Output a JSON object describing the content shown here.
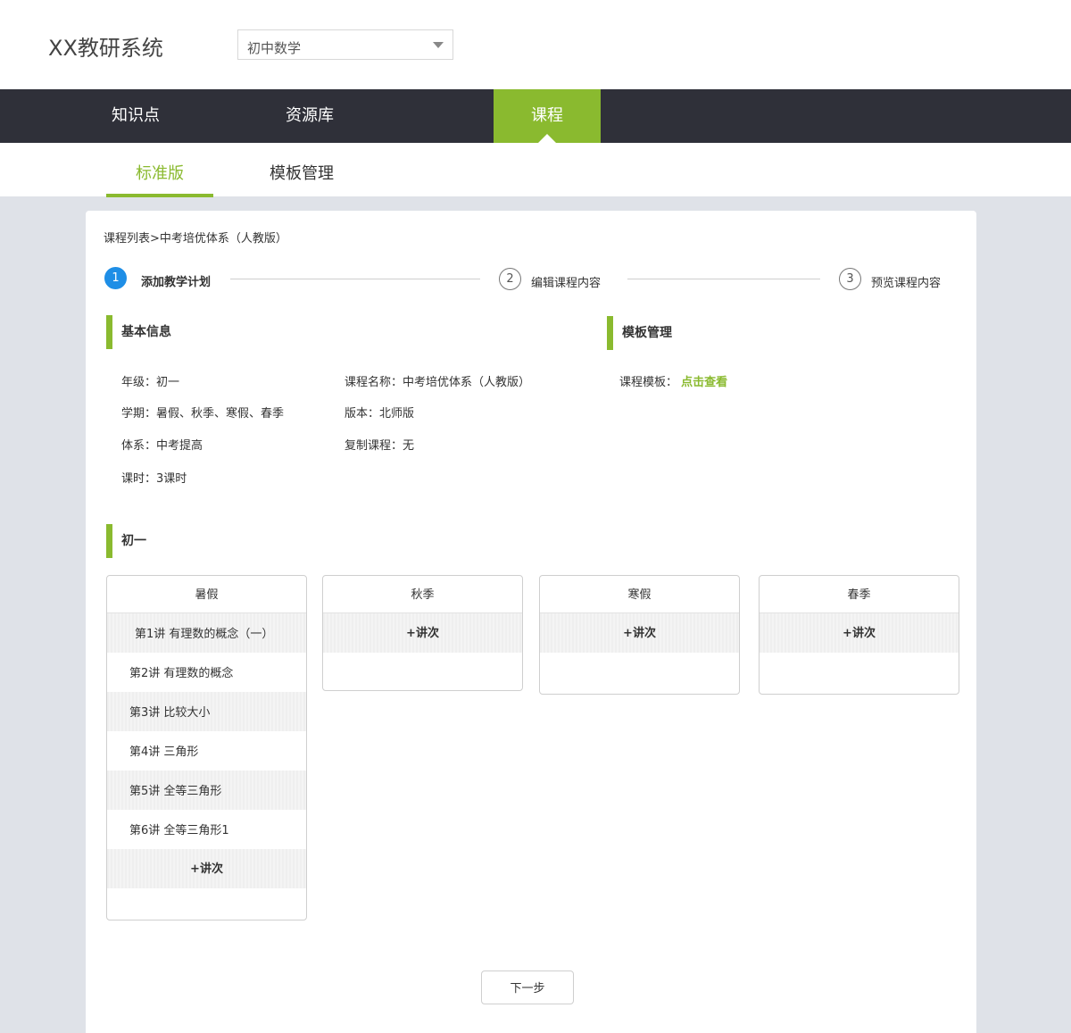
{
  "header": {
    "logo": "XX教研系统",
    "subject_select": "初中数学"
  },
  "topnav": {
    "items": [
      "知识点",
      "资源库",
      "课程"
    ],
    "active": "课程"
  },
  "subnav": {
    "items": [
      "标准版",
      "模板管理"
    ],
    "active": "标准版"
  },
  "breadcrumb": "课程列表>中考培优体系（人教版）",
  "steps": [
    {
      "num": "1",
      "label": "添加教学计划"
    },
    {
      "num": "2",
      "label": "编辑课程内容"
    },
    {
      "num": "3",
      "label": "预览课程内容"
    }
  ],
  "basic_info": {
    "title": "基本信息",
    "grade": "年级：初一",
    "term": "学期：暑假、秋季、寒假、春季",
    "system": "体系：中考提高",
    "hours": "课时：3课时",
    "course_name": "课程名称：中考培优体系（人教版）",
    "edition": "版本：北师版",
    "copy_course": "复制课程：无"
  },
  "template_mgmt": {
    "title": "模板管理",
    "label": "课程模板：",
    "link": "点击查看"
  },
  "grade_section": {
    "title": "初一",
    "terms": [
      {
        "name": "暑假",
        "lessons": [
          "第1讲 有理数的概念（一）",
          "第2讲 有理数的概念",
          "第3讲 比较大小",
          "第4讲 三角形",
          "第5讲 全等三角形",
          "第6讲 全等三角形1"
        ],
        "add": "+讲次"
      },
      {
        "name": "秋季",
        "lessons": [],
        "add": "+讲次"
      },
      {
        "name": "寒假",
        "lessons": [],
        "add": "+讲次"
      },
      {
        "name": "春季",
        "lessons": [],
        "add": "+讲次"
      }
    ]
  },
  "next_button": "下一步",
  "colors": {
    "accent": "#8aba2f",
    "nav_bg": "#2f3039",
    "step_active": "#1e8ee6",
    "page_bg": "#dfe2e8"
  }
}
